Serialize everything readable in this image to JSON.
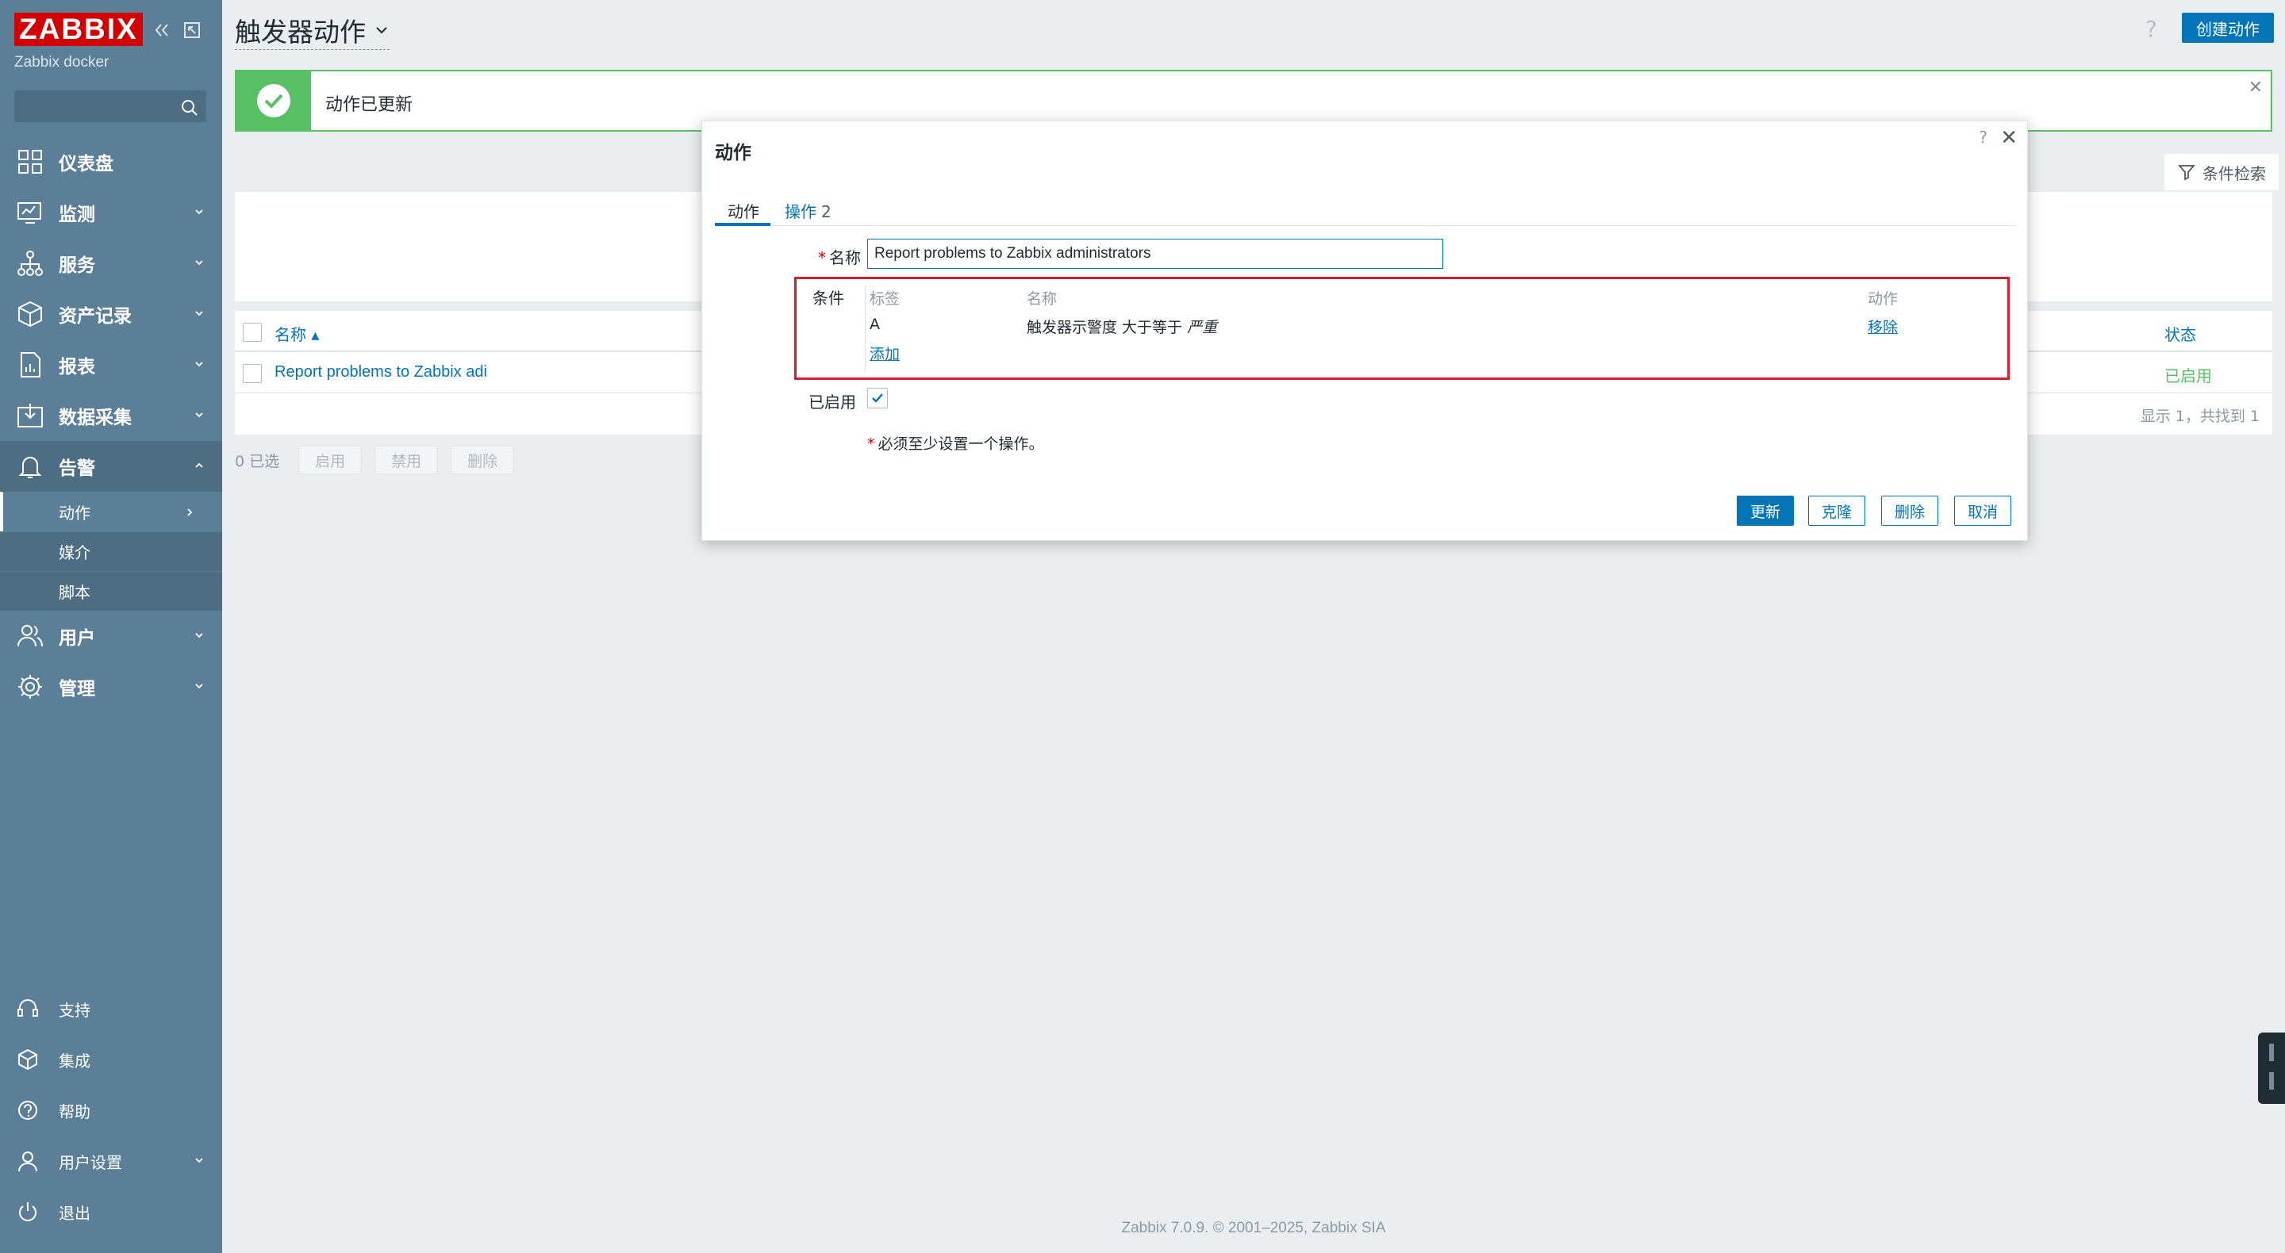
{
  "sidebar": {
    "logo": "ZABBIX",
    "server_name": "Zabbix docker",
    "search_placeholder": "",
    "menu": [
      {
        "label": "仪表盘"
      },
      {
        "label": "监测"
      },
      {
        "label": "服务"
      },
      {
        "label": "资产记录"
      },
      {
        "label": "报表"
      },
      {
        "label": "数据采集"
      },
      {
        "label": "告警"
      },
      {
        "label": "用户"
      },
      {
        "label": "管理"
      }
    ],
    "alerts_submenu": [
      {
        "label": "动作"
      },
      {
        "label": "媒介"
      },
      {
        "label": "脚本"
      }
    ],
    "bottom": [
      {
        "label": "支持"
      },
      {
        "label": "集成"
      },
      {
        "label": "帮助"
      },
      {
        "label": "用户设置"
      },
      {
        "label": "退出"
      }
    ]
  },
  "header": {
    "title": "触发器动作",
    "help": "?",
    "create_button": "创建动作"
  },
  "message": {
    "text": "动作已更新"
  },
  "filter": {
    "label": "条件检索"
  },
  "table": {
    "col_name": "名称 ▴",
    "col_status": "状态",
    "rows": [
      {
        "name": "Report problems to Zabbix adi",
        "status": "已启用"
      }
    ],
    "footer_count": "显示 1，共找到 1"
  },
  "action_bar": {
    "selected": "0 已选",
    "enable": "启用",
    "disable": "禁用",
    "delete": "删除"
  },
  "dialog": {
    "title": "动作",
    "help": "?",
    "close": "✕",
    "tab_action": "动作",
    "tab_operations": "操作",
    "tab_operations_count": "2",
    "label_name": "名称",
    "name_value": "Report problems to Zabbix administrators",
    "label_conditions": "条件",
    "cond_headers": {
      "label": "标签",
      "name": "名称",
      "action": "动作"
    },
    "conditions": [
      {
        "label": "A",
        "name_prefix": "触发器示警度 大于等于",
        "name_value": "严重",
        "action": "移除"
      }
    ],
    "add_link": "添加",
    "label_enabled": "已启用",
    "enabled": true,
    "note": "必须至少设置一个操作。",
    "buttons": {
      "update": "更新",
      "clone": "克隆",
      "delete": "删除",
      "cancel": "取消"
    }
  },
  "footer": "Zabbix 7.0.9. © 2001–2025, Zabbix SIA",
  "colors": {
    "sidebar": "#5b7f96",
    "brand": "#d40000",
    "primary": "#0275b8",
    "success": "#59bf64",
    "highlight": "#d4202b"
  }
}
